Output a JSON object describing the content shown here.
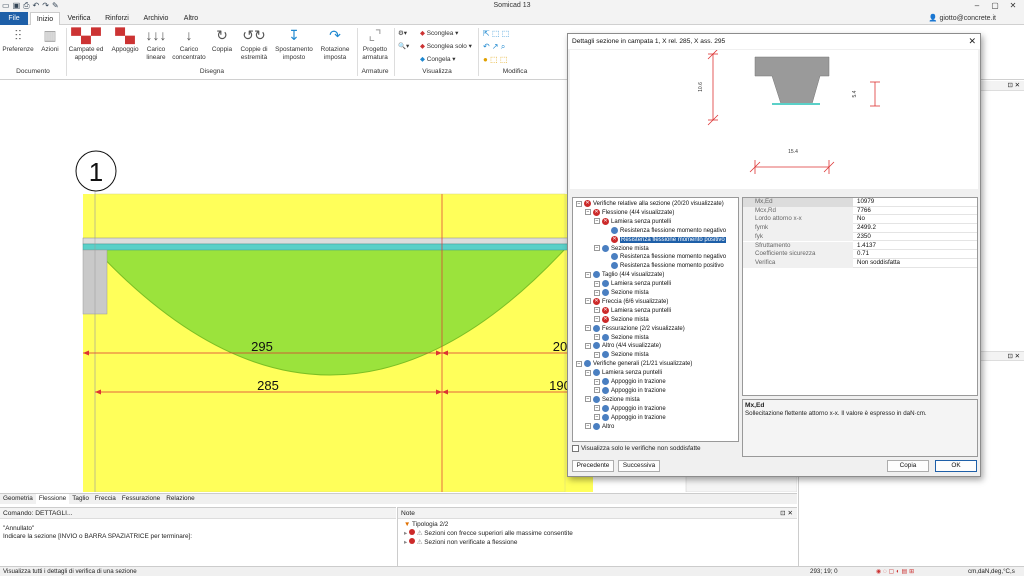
{
  "window": {
    "title": "Somicad 13",
    "user": "giotto@concrete.it"
  },
  "tabs": [
    "File",
    "Inizio",
    "Verifica",
    "Rinforzi",
    "Archivio",
    "Altro"
  ],
  "ribbon": {
    "buttons": [
      {
        "label": "Preferenze",
        "icon": "sliders-icon"
      },
      {
        "label": "Azioni",
        "icon": "actions-icon"
      },
      {
        "label": "Campate ed appoggi",
        "icon": "spans-icon"
      },
      {
        "label": "Appoggio",
        "icon": "support-icon"
      },
      {
        "label": "Carico lineare",
        "icon": "line-load-icon"
      },
      {
        "label": "Carico concentrato",
        "icon": "point-load-icon"
      },
      {
        "label": "Coppia",
        "icon": "moment-icon"
      },
      {
        "label": "Coppie di estremità",
        "icon": "end-moments-icon"
      },
      {
        "label": "Spostamento imposto",
        "icon": "displacement-icon"
      },
      {
        "label": "Rotazione imposta",
        "icon": "rotation-icon"
      },
      {
        "label": "Progetto armatura",
        "icon": "rebar-design-icon"
      }
    ],
    "groups": [
      "Documento",
      "Disegna",
      "Armature",
      "Visualizza",
      "Modifica"
    ],
    "view_items": [
      "Sconglea",
      "Sconglea solo",
      "Congela"
    ]
  },
  "drawing": {
    "span_label": "1",
    "dims_top": [
      "295",
      "20"
    ],
    "dims_bottom": [
      "285",
      "190"
    ]
  },
  "bottom_tabs": [
    "Geometria",
    "Flessione",
    "Taglio",
    "Freccia",
    "Fessurazione",
    "Relazione"
  ],
  "command": {
    "header": "Comando: DETTAGLI...",
    "lines": [
      "\"Annullato\"",
      "Indicare la sezione [INVIO o BARRA SPAZIATRICE per terminare]:"
    ]
  },
  "notes": {
    "header": "Note",
    "typology": "Tipologia 2/2",
    "items": [
      "Sezioni con frecce superiori alle massime consentite",
      "Sezioni non verificate a flessione"
    ]
  },
  "status": {
    "left": "Visualizza tutti i dettagli di verifica di una sezione",
    "coords": "293; 19; 0",
    "units": "cm,daN,deg,°C,s"
  },
  "dialog": {
    "title": "Dettagli sezione in campata 1, X rel. 285, X ass. 295",
    "dims": {
      "height": "10.6",
      "top_width": "15.4",
      "web": "5.4"
    },
    "tree": [
      {
        "level": 0,
        "status": "ko",
        "label": "Verifiche relative alla sezione (20/20 visualizzate)"
      },
      {
        "level": 1,
        "status": "ko",
        "label": "Flessione (4/4 visualizzate)"
      },
      {
        "level": 2,
        "status": "ko",
        "label": "Lamiera senza puntelli"
      },
      {
        "level": 3,
        "status": "ok",
        "label": "Resistenza flessione momento negativo"
      },
      {
        "level": 3,
        "status": "ko",
        "label": "Resistenza flessione momento positivo",
        "selected": true
      },
      {
        "level": 2,
        "status": "ok",
        "label": "Sezione mista"
      },
      {
        "level": 3,
        "status": "ok",
        "label": "Resistenza flessione momento negativo"
      },
      {
        "level": 3,
        "status": "ok",
        "label": "Resistenza flessione momento positivo"
      },
      {
        "level": 1,
        "status": "ok",
        "label": "Taglio (4/4 visualizzate)"
      },
      {
        "level": 2,
        "status": "ok",
        "label": "Lamiera senza puntelli"
      },
      {
        "level": 2,
        "status": "ok",
        "label": "Sezione mista"
      },
      {
        "level": 1,
        "status": "ko",
        "label": "Freccia (6/6 visualizzate)"
      },
      {
        "level": 2,
        "status": "ko",
        "label": "Lamiera senza puntelli"
      },
      {
        "level": 2,
        "status": "ko",
        "label": "Sezione mista"
      },
      {
        "level": 1,
        "status": "ok",
        "label": "Fessurazione (2/2 visualizzate)"
      },
      {
        "level": 2,
        "status": "ok",
        "label": "Sezione mista"
      },
      {
        "level": 1,
        "status": "ok",
        "label": "Altro (4/4 visualizzate)"
      },
      {
        "level": 2,
        "status": "ok",
        "label": "Sezione mista"
      },
      {
        "level": 0,
        "status": "ok",
        "label": "Verifiche generali (21/21 visualizzate)"
      },
      {
        "level": 1,
        "status": "ok",
        "label": "Lamiera senza puntelli"
      },
      {
        "level": 2,
        "status": "ok",
        "label": "Appoggio in trazione"
      },
      {
        "level": 2,
        "status": "ok",
        "label": "Appoggio in trazione"
      },
      {
        "level": 1,
        "status": "ok",
        "label": "Sezione mista"
      },
      {
        "level": 2,
        "status": "ok",
        "label": "Appoggio in trazione"
      },
      {
        "level": 2,
        "status": "ok",
        "label": "Appoggio in trazione"
      },
      {
        "level": 1,
        "status": "ok",
        "label": "Altro"
      }
    ],
    "props": [
      {
        "k": "Mx,Ed",
        "v": "10979"
      },
      {
        "k": "Mcx,Rd",
        "v": "7766"
      },
      {
        "k": "Lordo attorno x-x",
        "v": "No"
      },
      {
        "k": "fymk",
        "v": "2499.2"
      },
      {
        "k": "fyk",
        "v": "2350"
      },
      {
        "k": "Sfruttamento",
        "v": "1.4137"
      },
      {
        "k": "Coefficiente sicurezza",
        "v": "0.71"
      },
      {
        "k": "Verifica",
        "v": "Non soddisfatta"
      }
    ],
    "desc": {
      "title": "Mx,Ed",
      "text": "Sollecitazione flettente attorno x-x. Il valore è espresso in daN·cm."
    },
    "checkbox": "Visualizza solo le verifiche non soddisfatte",
    "buttons": {
      "prev": "Precedente",
      "next": "Successiva",
      "copy": "Copia",
      "ok": "OK"
    }
  }
}
